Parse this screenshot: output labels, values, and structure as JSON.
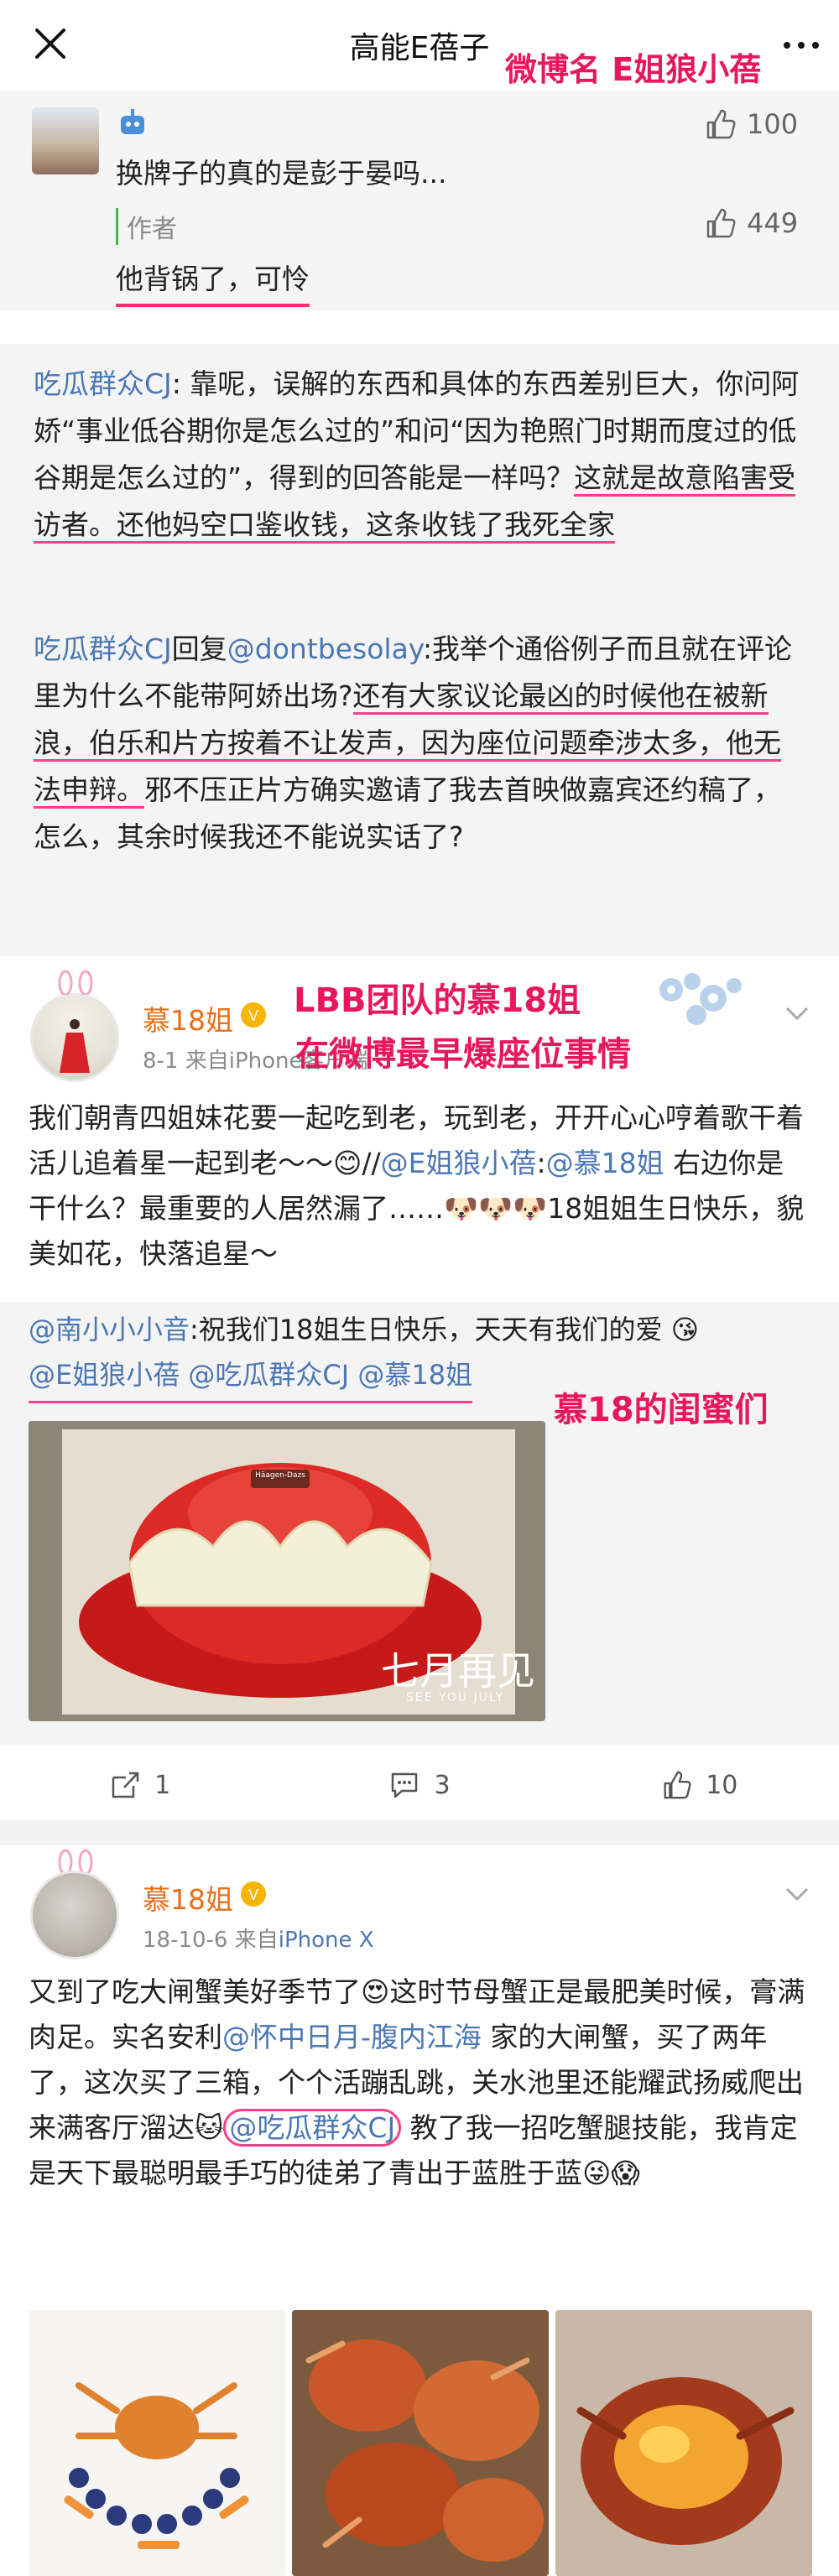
{
  "header": {
    "title": "高能E蓓子",
    "annotation": "微博名 E姐狼小蓓"
  },
  "comments": [
    {
      "text": "换牌子的真的是彭于晏吗...",
      "likes": "100"
    },
    {
      "author_tag": "作者",
      "text": "他背锅了，可怜",
      "likes": "449"
    }
  ],
  "quote1": {
    "p1_user": "吃瓜群众CJ",
    "p1_sep": ": ",
    "p1_text": "靠呢，误解的东西和具体的东西差别巨大，你问阿娇“事业低谷期你是怎么过的”和问“因为艳照门时期而度过的低谷期是怎么过的”，得到的回答能是一样吗？",
    "p1_hl": "这就是故意陷害受访者。还他妈空口鉴收钱，这条收钱了我死全家",
    "p2_user": "吃瓜群众CJ",
    "p2_reply": "回复",
    "p2_mention": "@dontbesolay",
    "p2_text": ":我举个通俗例子而且就在评论里为什么不能带阿娇出场?",
    "p2_hl": "还有大家议论最凶的时候他在被新浪，伯乐和片方按着不让发声，因为座位问题牵涉太多，他无法申辩。",
    "p2_rest": "邪不压正片方确实邀请了我去首映做嘉宾还约稿了，怎么，其余时候我还不能说实话了?"
  },
  "post1": {
    "username": "慕18姐",
    "meta": "8-1  来自iPhone客户端",
    "annotation_line1": "LBB团队的慕18姐",
    "annotation_line2": "在微博最早爆座位事情",
    "body_a": "我们朝青四姐妹花要一起吃到老，玩到老，开开心心哼着歌干着活儿追着星一起到老～～😊//",
    "body_mention": "@E姐狼小蓓",
    "body_b": ":",
    "body_mention2": "@慕18姐",
    "body_c": " 右边你是干什么？最重要的人居然漏了……🐶🐶🐶18姐姐生日快乐，貌美如花，快落追星～",
    "repost_user": "@南小小小音",
    "repost_text": ":祝我们18姐生日快乐，天天有我们的爱 😘",
    "repost_mentions": "@E姐狼小蓓 @吃瓜群众CJ  @慕18姐",
    "annotation2": "慕18的闺蜜们",
    "image_caption": "七月再见",
    "image_sub": "SEE YOU JULY",
    "cake_brand": "Häagen-Dazs",
    "reposts": "1",
    "comments": "3",
    "likes": "10"
  },
  "post2": {
    "username": "慕18姐",
    "meta_date": "18-10-6  来自",
    "meta_device": "iPhone X",
    "body_a": "又到了吃大闸蟹美好季节了😍这时节母蟹正是最肥美时候，膏满肉足。实名安利",
    "body_mention": "@怀中日月-腹内江海",
    "body_b": " 家的大闸蟹，买了两年了，这次买了三箱，个个活蹦乱跳，关水池里还能耀武扬威爬出来满客厅溜达🐱",
    "body_mention2": "@吃瓜群众CJ",
    "body_c": " 教了我一招吃蟹腿技能，我肯定是天下最聪明最手巧的徒弟了青出于蓝胜于蓝😜😱"
  },
  "colors": {
    "link": "#4b77b5",
    "annotation": "#e8175d",
    "highlight": "#ff3f8a"
  }
}
